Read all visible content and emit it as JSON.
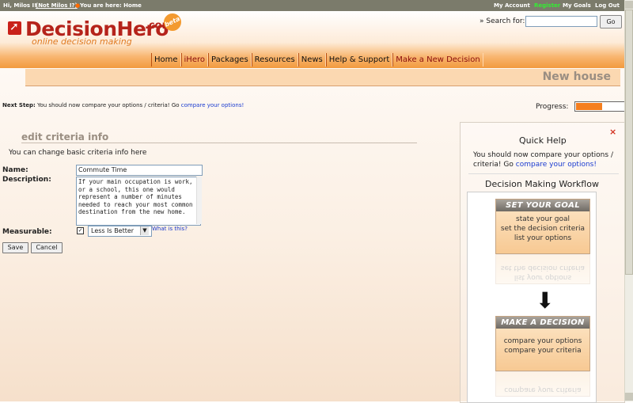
{
  "topbar": {
    "greeting": "Hi, Milos I!",
    "not_user": "(Not Milos I?)",
    "location": "You are here: Home",
    "links": [
      "My Account",
      "Register",
      "My Goals",
      "Log Out"
    ]
  },
  "brand": {
    "name": "DecisionHero",
    "tld": ".com",
    "badge": "beta",
    "tagline": "online decision making"
  },
  "search": {
    "label": "» Search for:",
    "value": "",
    "button": "Go"
  },
  "nav": [
    "Home",
    "iHero",
    "Packages",
    "Resources",
    "News",
    "Help & Support",
    "Make a New Decision"
  ],
  "page_title": "New house",
  "next_step": {
    "label": "Next Step:",
    "text": "You should now compare your options / criteria! Go",
    "link": "compare your options!"
  },
  "progress": {
    "label": "Progress:",
    "value": 0.55,
    "fill_color": "#f47f1f"
  },
  "form": {
    "section_title": "edit criteria info",
    "intro": "You can change basic criteria info here",
    "name_label": "Name:",
    "name_value": "Commute Time",
    "description_label": "Description:",
    "description_value": "If your main occupation is work, or a school, this one would represent a number of minutes needed to reach your most common destination from the new home.",
    "measurable_label": "Measurable:",
    "measurable_checked": "✓",
    "measurable_option": "Less Is Better",
    "what_is_this": "What is this?",
    "save": "Save",
    "cancel": "Cancel"
  },
  "quick_help": {
    "close": "×",
    "title": "Quick Help",
    "text": "You should now compare your options / criteria! Go",
    "link": "compare your options!",
    "workflow_title": "Decision Making Workflow",
    "card1": {
      "head": "SET YOUR GOAL",
      "lines": [
        "state your goal",
        "set the decision criteria",
        "list your options"
      ]
    },
    "card2": {
      "head": "MAKE A DECISION",
      "lines": [
        "compare your options",
        "compare your criteria"
      ]
    }
  },
  "colors": {
    "accent": "#f47f1f",
    "brand_red": "#b5231b",
    "link": "#1a3bd0"
  }
}
